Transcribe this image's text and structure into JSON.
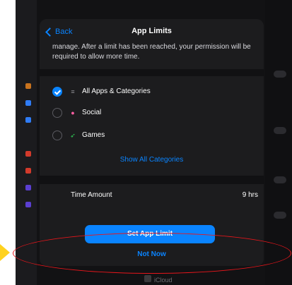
{
  "nav": {
    "back_label": "Back",
    "title": "App Limits"
  },
  "description": "manage. After a limit has been reached, your permission will be required to allow more time.",
  "categories": [
    {
      "label": "All Apps & Categories",
      "selected": true,
      "icon": "layers-icon",
      "color": "#8e8e93"
    },
    {
      "label": "Social",
      "selected": false,
      "icon": "social-icon",
      "color": "#ff5fa2"
    },
    {
      "label": "Games",
      "selected": false,
      "icon": "rocket-icon",
      "color": "#30d158"
    }
  ],
  "show_all_label": "Show All Categories",
  "time": {
    "label": "Time Amount",
    "value": "9 hrs"
  },
  "buttons": {
    "set_limit": "Set App Limit",
    "not_now": "Not Now"
  },
  "background": {
    "bottom_label": "iCloud"
  },
  "colors": {
    "accent": "#0a84ff",
    "annotation": "#e8161b",
    "arrow": "#ffd21f"
  }
}
